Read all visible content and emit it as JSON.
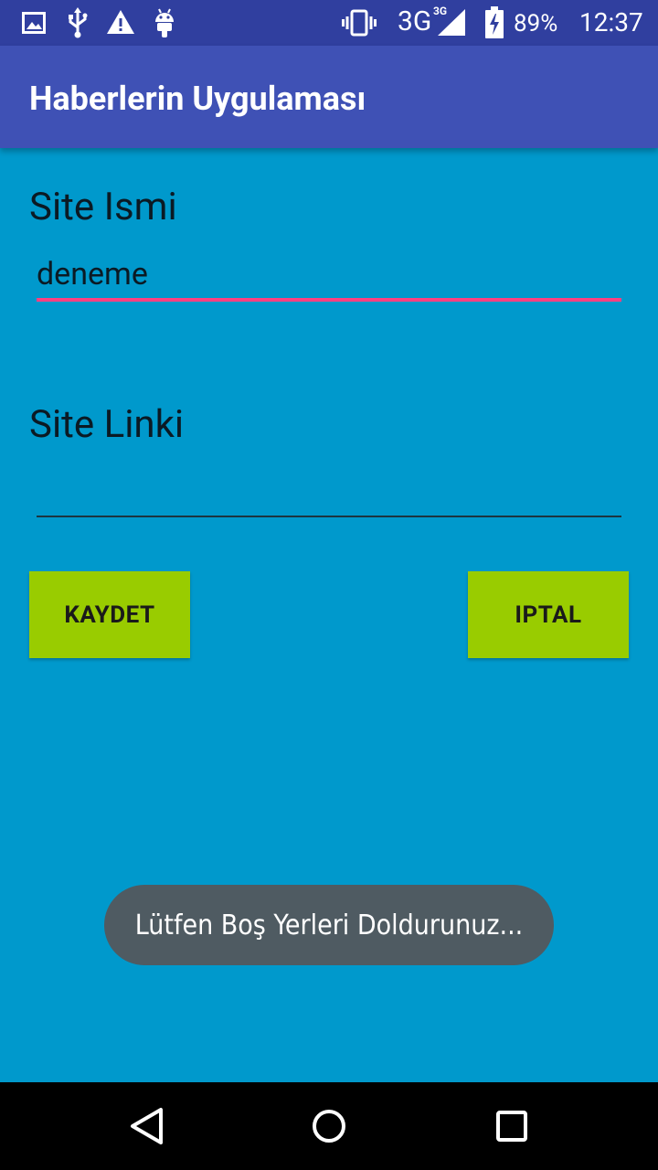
{
  "status_bar": {
    "icons": [
      "image-icon",
      "usb-icon",
      "warning-icon",
      "android-icon",
      "vibrate-icon",
      "signal-icon",
      "battery-icon"
    ],
    "network": "3G",
    "network_small": "3G",
    "battery_percent": "89%",
    "time": "12:37"
  },
  "app_bar": {
    "title": "Haberlerin Uygulaması"
  },
  "form": {
    "site_name_label": "Site Ismi",
    "site_name_value": "deneme",
    "site_link_label": "Site Linki",
    "site_link_value": ""
  },
  "buttons": {
    "save_label": "KAYDET",
    "cancel_label": "IPTAL"
  },
  "toast": {
    "message": "Lütfen Boş Yerleri Doldurunuz..."
  },
  "nav_bar": {
    "icons": [
      "back-icon",
      "home-icon",
      "recents-icon"
    ]
  },
  "colors": {
    "background": "#0099cc",
    "status_bar": "#303f9f",
    "app_bar": "#3f51b5",
    "accent_underline": "#ff4081",
    "button": "#99cc00",
    "toast": "#4f5b62"
  }
}
